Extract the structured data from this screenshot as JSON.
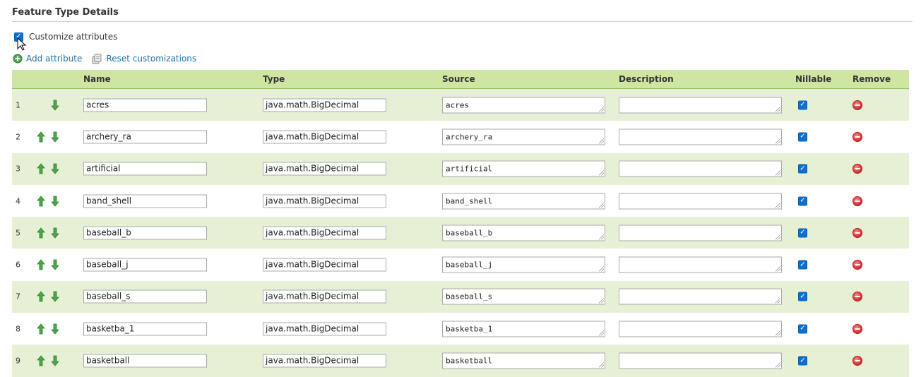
{
  "section": {
    "title": "Feature Type Details"
  },
  "customize": {
    "label": "Customize attributes",
    "checked": true
  },
  "actions": {
    "add": "Add attribute",
    "reset": "Reset customizations"
  },
  "table": {
    "headers": {
      "name": "Name",
      "type": "Type",
      "source": "Source",
      "description": "Description",
      "nillable": "Nillable",
      "remove": "Remove"
    },
    "rows": [
      {
        "num": "1",
        "name": "acres",
        "type": "java.math.BigDecimal",
        "source": "acres",
        "description": "",
        "nillable": true
      },
      {
        "num": "2",
        "name": "archery_ra",
        "type": "java.math.BigDecimal",
        "source": "archery_ra",
        "description": "",
        "nillable": true
      },
      {
        "num": "3",
        "name": "artificial",
        "type": "java.math.BigDecimal",
        "source": "artificial",
        "description": "",
        "nillable": true
      },
      {
        "num": "4",
        "name": "band_shell",
        "type": "java.math.BigDecimal",
        "source": "band_shell",
        "description": "",
        "nillable": true
      },
      {
        "num": "5",
        "name": "baseball_b",
        "type": "java.math.BigDecimal",
        "source": "baseball_b",
        "description": "",
        "nillable": true
      },
      {
        "num": "6",
        "name": "baseball_j",
        "type": "java.math.BigDecimal",
        "source": "baseball_j",
        "description": "",
        "nillable": true
      },
      {
        "num": "7",
        "name": "baseball_s",
        "type": "java.math.BigDecimal",
        "source": "baseball_s",
        "description": "",
        "nillable": true
      },
      {
        "num": "8",
        "name": "basketba_1",
        "type": "java.math.BigDecimal",
        "source": "basketba_1",
        "description": "",
        "nillable": true
      },
      {
        "num": "9",
        "name": "basketball",
        "type": "java.math.BigDecimal",
        "source": "basketball",
        "description": "",
        "nillable": true
      }
    ]
  },
  "colors": {
    "header_bg": "#cfe6a3",
    "row_alt_bg": "#e6f0d5",
    "link": "#1d6fa5",
    "arrow": "#3a9a3a",
    "remove": "#d42a2a",
    "checkbox": "#0f6fd1"
  }
}
